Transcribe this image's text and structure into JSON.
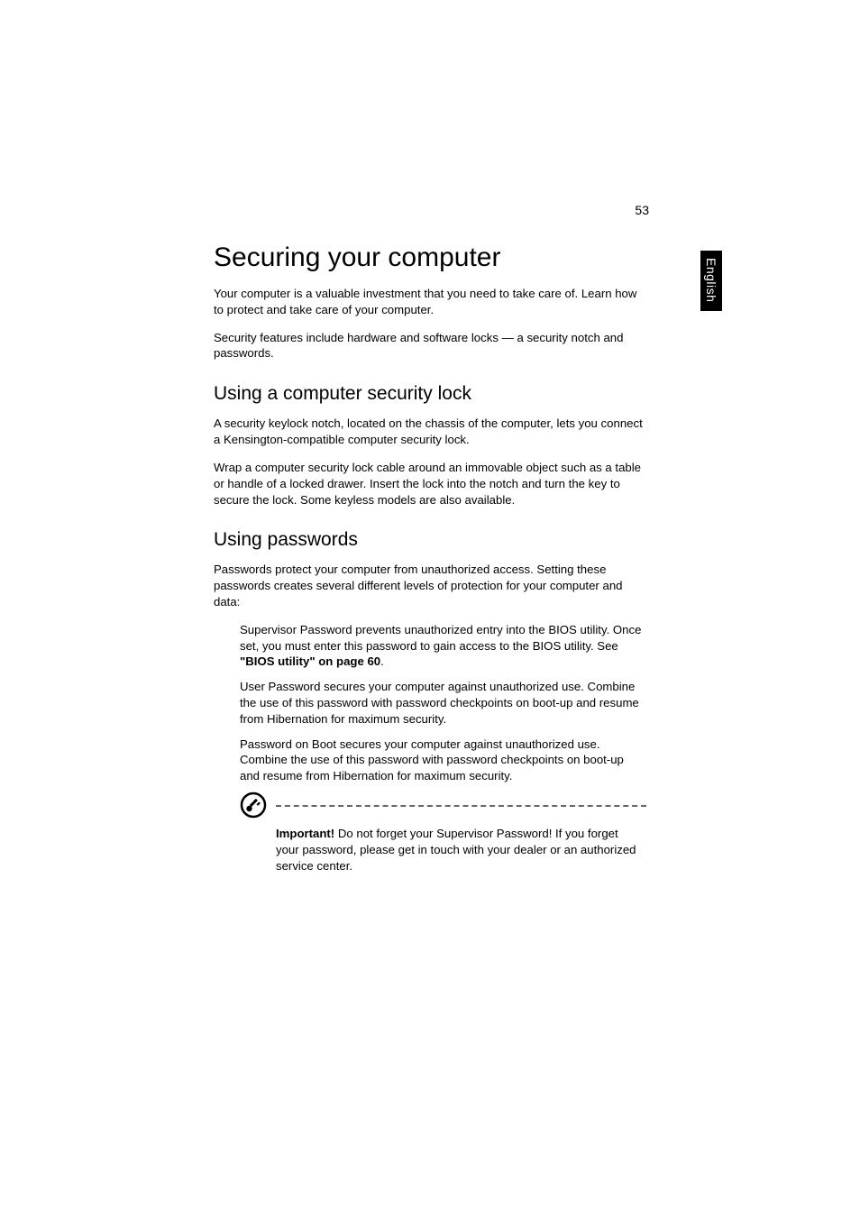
{
  "page_number": "53",
  "language_tab": "English",
  "title": "Securing your computer",
  "intro_p1": "Your computer is a valuable investment that you need to take care of. Learn how to protect and take care of your computer.",
  "intro_p2": "Security features include hardware and software locks — a security notch and passwords.",
  "section1": {
    "heading": "Using a computer security lock",
    "p1": "A security keylock notch, located on the chassis of the computer, lets you connect a Kensington-compatible computer security lock.",
    "p2": "Wrap a computer security lock cable around an immovable object such as a table or handle of a locked drawer. Insert the lock into the notch and turn the key to secure the lock. Some keyless models are also available."
  },
  "section2": {
    "heading": "Using passwords",
    "p1": "Passwords protect your computer from unauthorized access. Setting these passwords creates several different levels of protection for your computer and data:",
    "items": {
      "supervisor_pre": "Supervisor Password prevents unauthorized entry into the BIOS utility. Once set, you must enter this password to gain access to the BIOS utility. See ",
      "supervisor_ref": "\"BIOS utility\" on page 60",
      "supervisor_post": ".",
      "user": "User Password secures your computer against unauthorized use. Combine the use of this password with password checkpoints on boot-up and resume from Hibernation for maximum security.",
      "boot": "Password on Boot secures your computer against unauthorized use. Combine the use of this password with password checkpoints on boot-up and resume from Hibernation for maximum security."
    },
    "note": {
      "label": "Important!",
      "text": " Do not forget your Supervisor Password! If you forget your password, please get in touch with your dealer or an authorized service center."
    }
  }
}
